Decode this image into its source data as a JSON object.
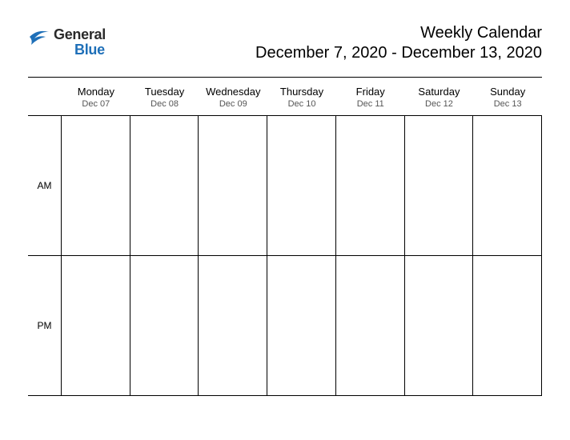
{
  "logo": {
    "word1": "General",
    "word2": "Blue"
  },
  "title": {
    "main": "Weekly Calendar",
    "range": "December 7, 2020 - December 13, 2020"
  },
  "periods": [
    "AM",
    "PM"
  ],
  "days": [
    {
      "name": "Monday",
      "date": "Dec 07"
    },
    {
      "name": "Tuesday",
      "date": "Dec 08"
    },
    {
      "name": "Wednesday",
      "date": "Dec 09"
    },
    {
      "name": "Thursday",
      "date": "Dec 10"
    },
    {
      "name": "Friday",
      "date": "Dec 11"
    },
    {
      "name": "Saturday",
      "date": "Dec 12"
    },
    {
      "name": "Sunday",
      "date": "Dec 13"
    }
  ]
}
